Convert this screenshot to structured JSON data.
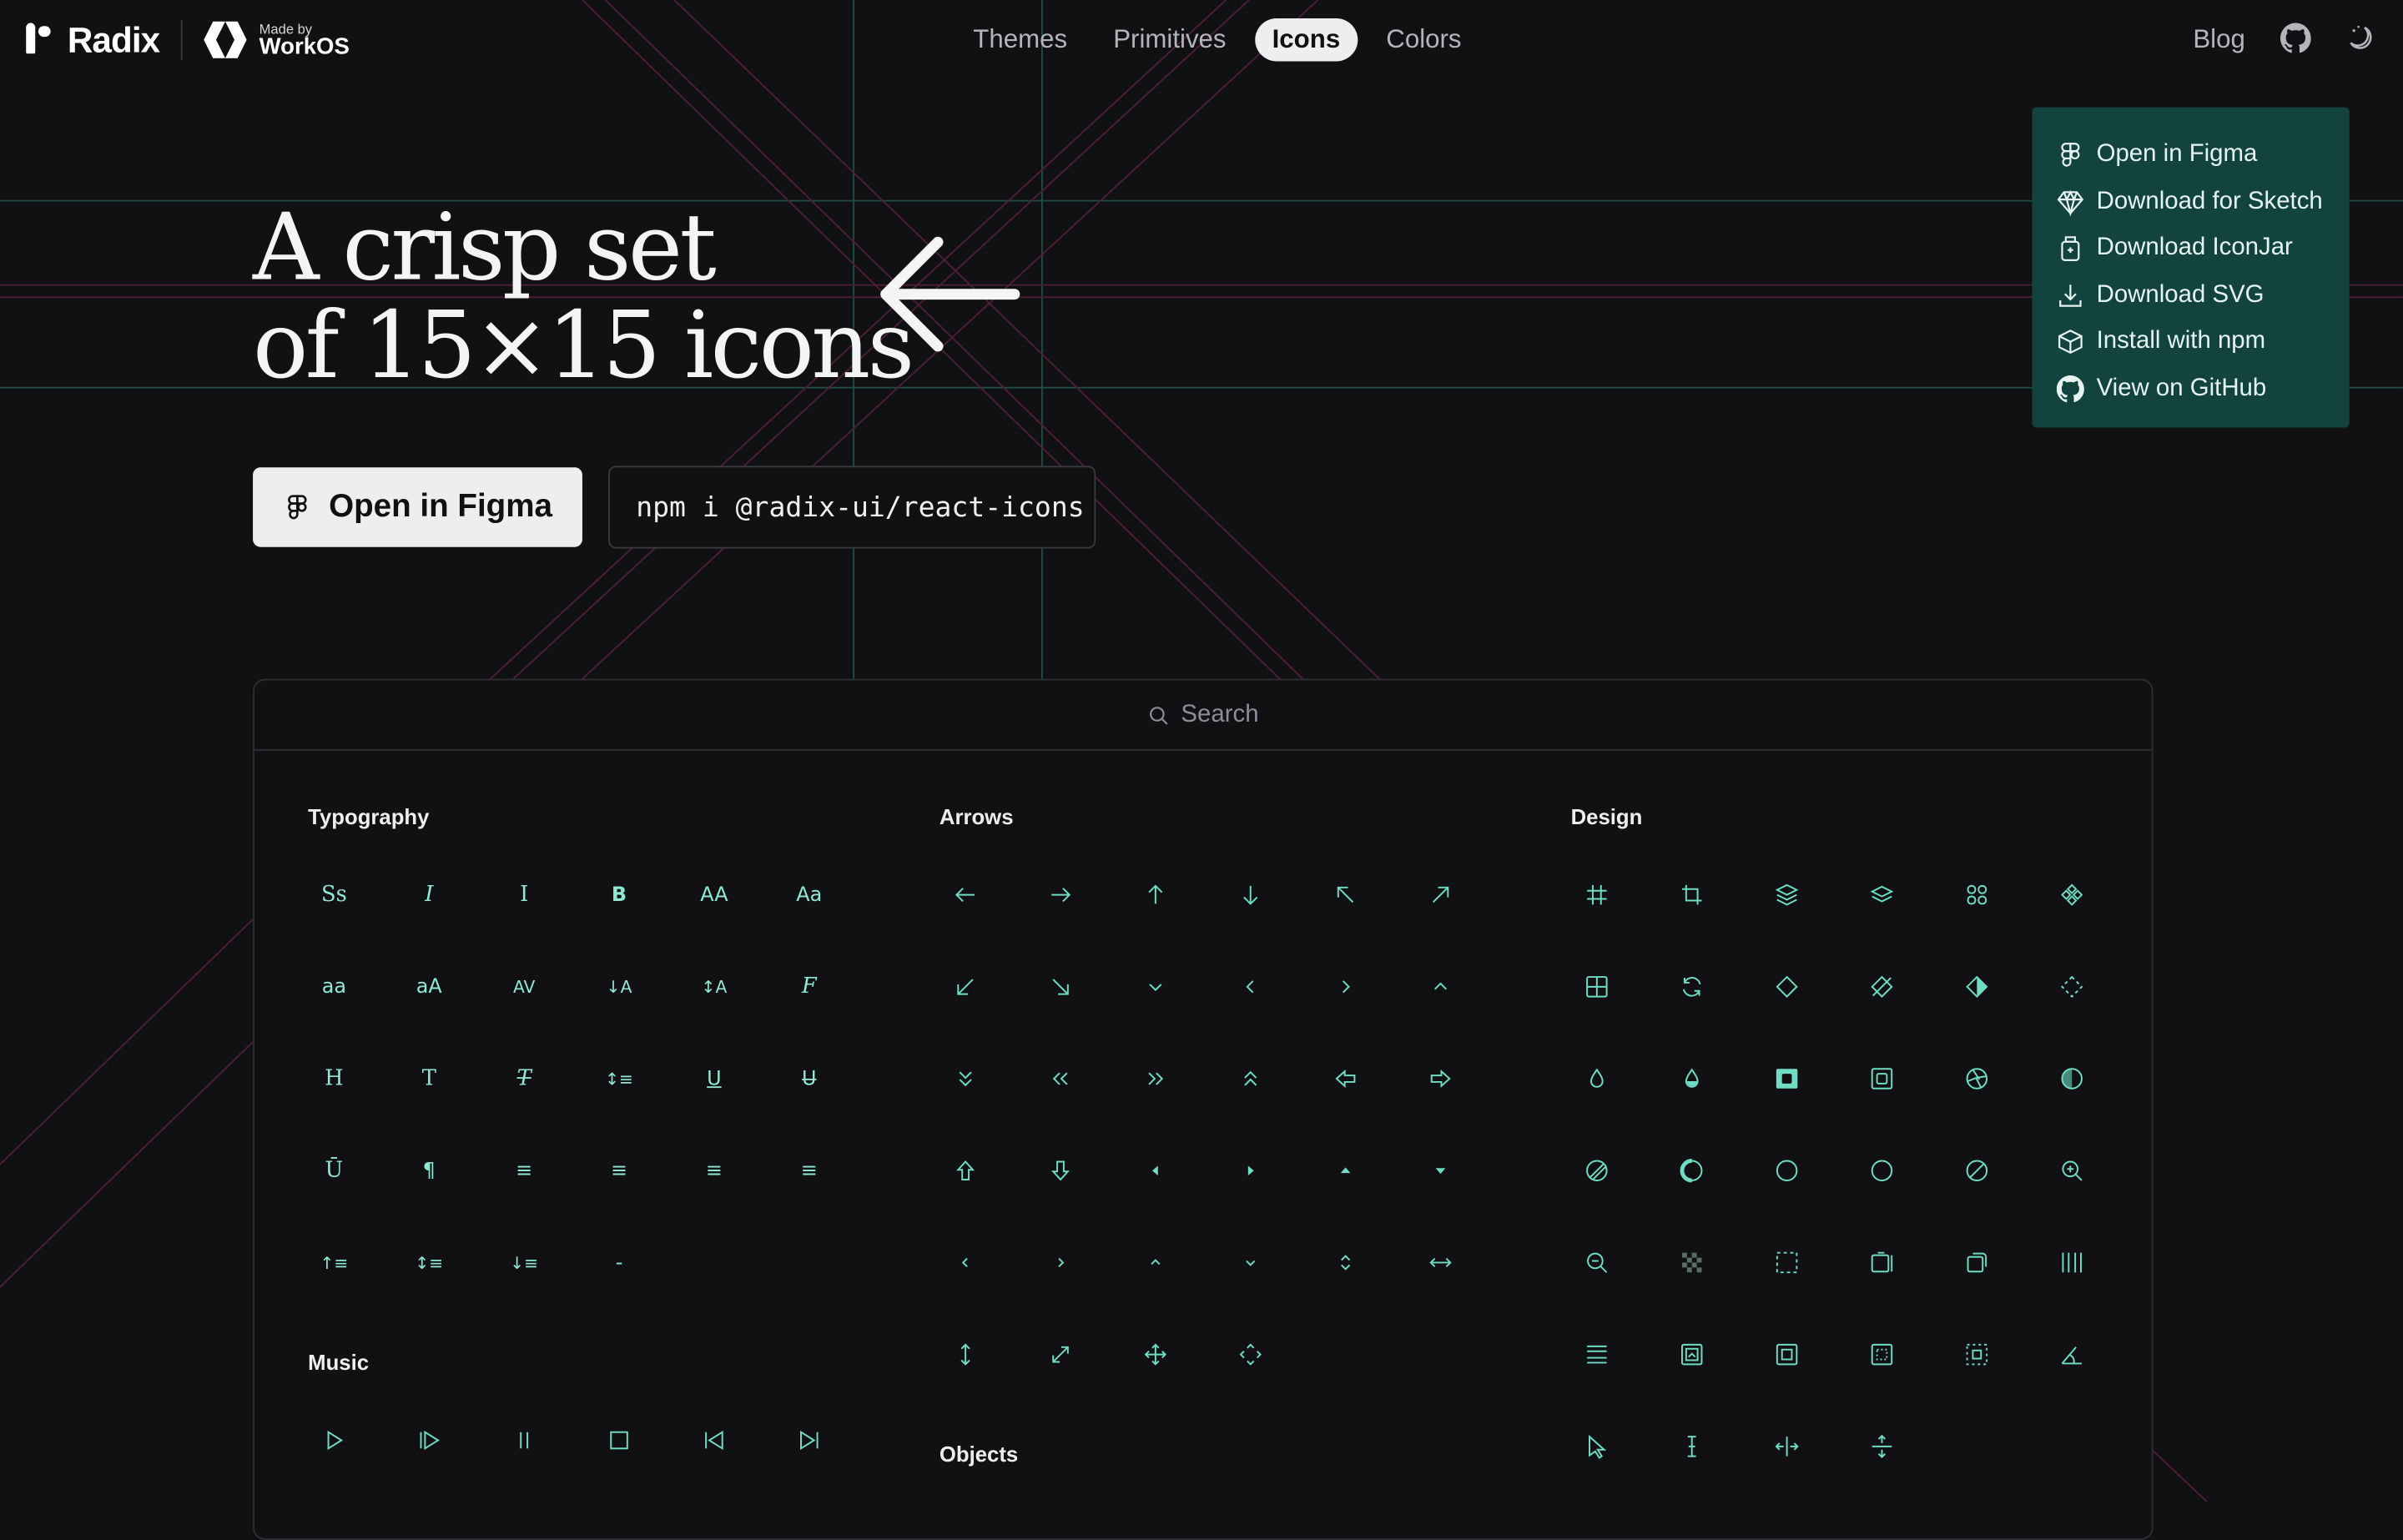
{
  "brand": {
    "name": "Radix",
    "made_by": "Made by",
    "partner": "WorkOS"
  },
  "nav": {
    "items": [
      "Themes",
      "Primitives",
      "Icons",
      "Colors"
    ],
    "active": "Icons"
  },
  "header_right": {
    "blog": "Blog",
    "github_icon": "github-icon",
    "theme_icon": "moon-icon"
  },
  "menu": {
    "items": [
      {
        "label": "Open in Figma",
        "icon": "figma-icon"
      },
      {
        "label": "Download for Sketch",
        "icon": "sketch-icon"
      },
      {
        "label": "Download IconJar",
        "icon": "iconjar-icon"
      },
      {
        "label": "Download SVG",
        "icon": "download-icon"
      },
      {
        "label": "Install with npm",
        "icon": "cube-icon"
      },
      {
        "label": "View on GitHub",
        "icon": "github-icon"
      }
    ],
    "bg": "#12433e"
  },
  "hero": {
    "line1": "A crisp set",
    "line2": "of 15×15 icons",
    "cta_label": "Open in Figma",
    "npm_command": "npm i @radix-ui/react-icons"
  },
  "search": {
    "placeholder": "Search"
  },
  "categories": {
    "typography": "Typography",
    "music": "Music",
    "arrows": "Arrows",
    "objects": "Objects",
    "design": "Design"
  },
  "typography_glyphs": {
    "r0": [
      "Ss",
      "I",
      "I",
      "B",
      "AA",
      "Aa"
    ],
    "r1": [
      "aa",
      "aA",
      "AV",
      "↓A",
      "↕A",
      "F"
    ],
    "r2": [
      "H",
      "T",
      "T",
      "↕≡",
      "U",
      "U"
    ],
    "r3": [
      "Ū",
      "¶",
      "≡",
      "≡",
      "≡",
      "≡"
    ],
    "r4": [
      "↑≡",
      "↕≡",
      "↓≡",
      "-"
    ]
  },
  "colors": {
    "accent": "#6fdcc4",
    "background": "#111113",
    "guide_teal": "#1f5a52",
    "guide_pink": "#5c2240"
  }
}
